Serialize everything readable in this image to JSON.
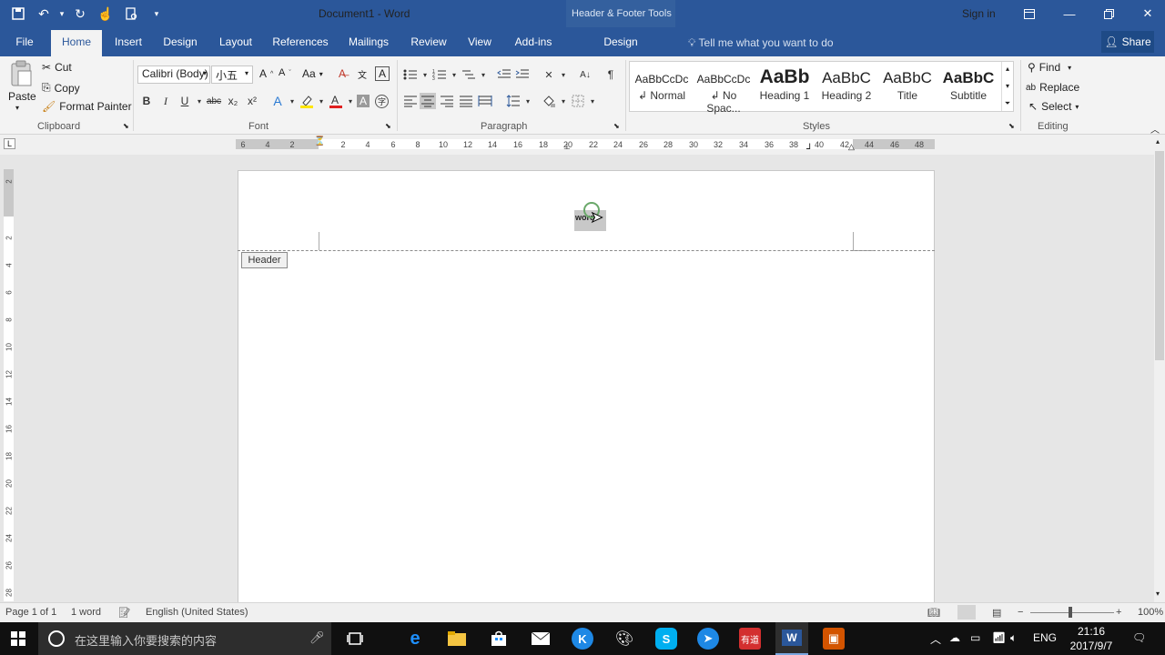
{
  "title_bar": {
    "document_title": "Document1 - Word",
    "contextual_group": "Header & Footer Tools",
    "sign_in": "Sign in",
    "qat_icons": [
      "save-icon",
      "undo-icon",
      "redo-icon",
      "touch-mode-icon",
      "print-preview-icon",
      "customize-qat-icon"
    ],
    "window_icons": [
      "ribbon-display-icon",
      "minimize-icon",
      "restore-icon",
      "close-icon"
    ]
  },
  "tabs": [
    "File",
    "Home",
    "Insert",
    "Design",
    "Layout",
    "References",
    "Mailings",
    "Review",
    "View",
    "Add-ins"
  ],
  "active_tab": "Home",
  "contextual_tab": "Design",
  "tell_me": "Tell me what you want to do",
  "share": "Share",
  "clipboard": {
    "paste": "Paste",
    "cut": "Cut",
    "copy": "Copy",
    "format_painter": "Format Painter",
    "label": "Clipboard"
  },
  "font": {
    "family": "Calibri (Body)",
    "size": "小五",
    "label": "Font",
    "bold": "B",
    "italic": "I",
    "underline": "U",
    "strike": "abc",
    "subscript": "x₂",
    "superscript": "x²",
    "grow": "A^",
    "shrink": "Aˇ",
    "case": "Aa"
  },
  "paragraph": {
    "label": "Paragraph"
  },
  "styles": {
    "label": "Styles",
    "items": [
      {
        "sample": "AaBbCcDc",
        "name": "Normal"
      },
      {
        "sample": "AaBbCcDc",
        "name": "No Spac..."
      },
      {
        "sample": "AaBb",
        "name": "Heading 1"
      },
      {
        "sample": "AaBbC",
        "name": "Heading 2"
      },
      {
        "sample": "AaBbC",
        "name": "Title"
      },
      {
        "sample": "AaBbC",
        "name": "Subtitle"
      }
    ]
  },
  "editing": {
    "find": "Find",
    "replace": "Replace",
    "select": "Select",
    "label": "Editing"
  },
  "ruler": {
    "tab_selector": "L",
    "h_ticks": [
      "6",
      "4",
      "2",
      "2",
      "4",
      "6",
      "8",
      "10",
      "12",
      "14",
      "16",
      "18",
      "20",
      "22",
      "24",
      "26",
      "28",
      "30",
      "32",
      "34",
      "36",
      "38",
      "40",
      "42",
      "44",
      "46",
      "48"
    ],
    "v_ticks": [
      "2",
      "2",
      "4",
      "6",
      "8",
      "10",
      "12",
      "14",
      "16",
      "18",
      "20",
      "22",
      "24",
      "26",
      "28"
    ]
  },
  "document": {
    "header_tag": "Header",
    "selected_text": "word"
  },
  "status_bar": {
    "page": "Page 1 of 1",
    "words": "1 word",
    "language": "English (United States)",
    "zoom": "100%"
  },
  "taskbar": {
    "search_placeholder": "在这里输入你要搜索的内容",
    "apps": [
      "task-view-icon",
      "edge-icon",
      "file-explorer-icon",
      "store-icon",
      "mail-icon",
      "kugou-icon",
      "paint-icon",
      "skype-icon",
      "browser-icon",
      "youdao-icon",
      "word-icon",
      "app-icon"
    ],
    "ime": "ENG",
    "time": "21:16",
    "date": "2017/9/7"
  }
}
